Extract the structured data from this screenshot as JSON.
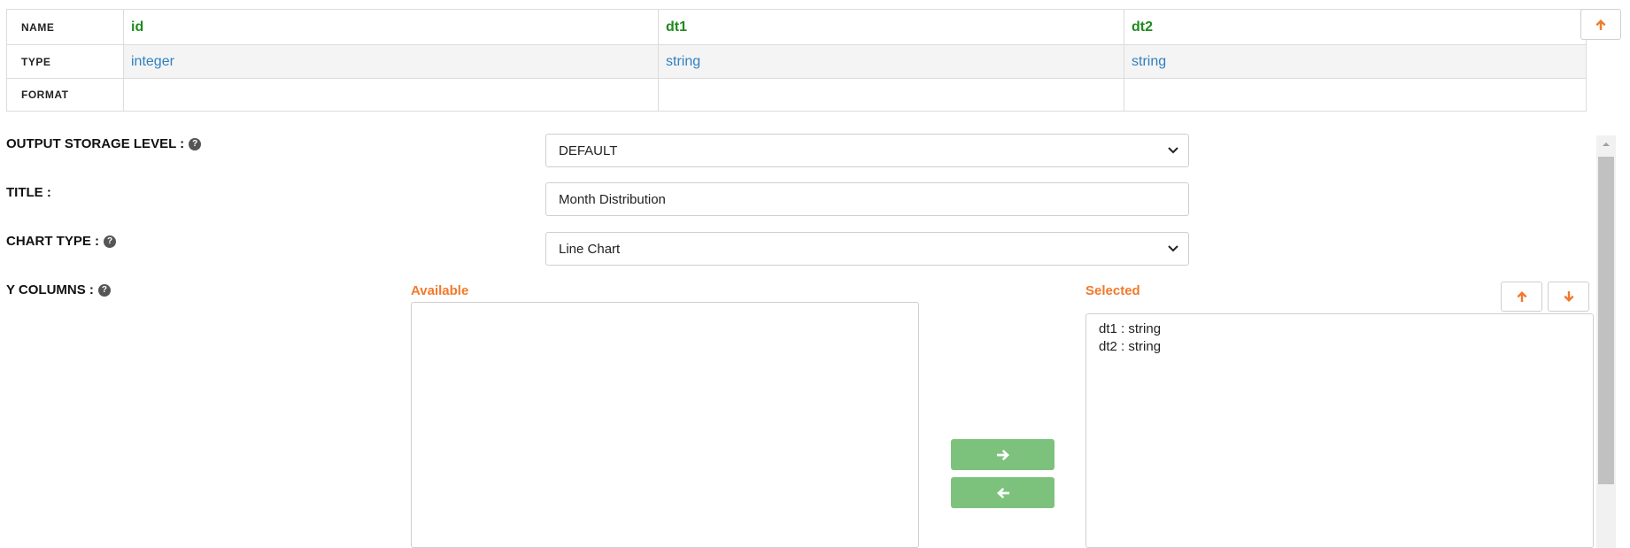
{
  "schema": {
    "row_labels": {
      "name": "NAME",
      "type": "TYPE",
      "format": "FORMAT"
    },
    "columns": [
      {
        "name": "id",
        "type": "integer",
        "format": ""
      },
      {
        "name": "dt1",
        "type": "string",
        "format": ""
      },
      {
        "name": "dt2",
        "type": "string",
        "format": ""
      }
    ]
  },
  "form": {
    "output_storage_level": {
      "label": "OUTPUT STORAGE LEVEL :",
      "value": "DEFAULT"
    },
    "title": {
      "label": "TITLE :",
      "value": "Month Distribution"
    },
    "chart_type": {
      "label": "CHART TYPE :",
      "value": "Line Chart"
    },
    "y_columns": {
      "label": "Y COLUMNS :",
      "available_title": "Available",
      "selected_title": "Selected",
      "available": [],
      "selected": [
        "dt1 : string",
        "dt2 : string"
      ]
    }
  },
  "icons": {
    "help": "question-circle-icon",
    "move_right": "arrow-right-icon",
    "move_left": "arrow-left-icon",
    "order_up": "arrow-up-icon",
    "order_down": "arrow-down-icon",
    "dropdown": "chevron-down-icon"
  },
  "colors": {
    "column_name": "#1f8a1f",
    "column_type": "#2f7fc1",
    "section_title": "#f07a2d",
    "move_button": "#7cc27d",
    "arrow_accent": "#f07a2d"
  }
}
